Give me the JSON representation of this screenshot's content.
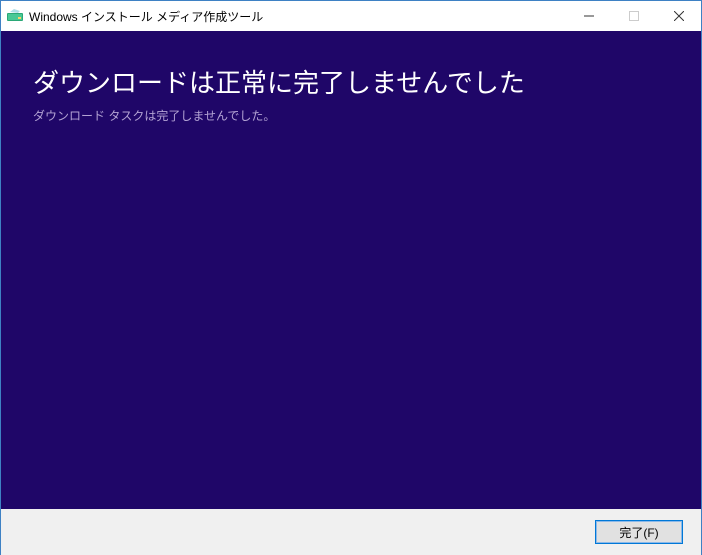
{
  "window": {
    "title": "Windows インストール メディア作成ツール"
  },
  "content": {
    "heading": "ダウンロードは正常に完了しませんでした",
    "subtext": "ダウンロード タスクは完了しませんでした。"
  },
  "footer": {
    "finish_label": "完了(F)"
  }
}
